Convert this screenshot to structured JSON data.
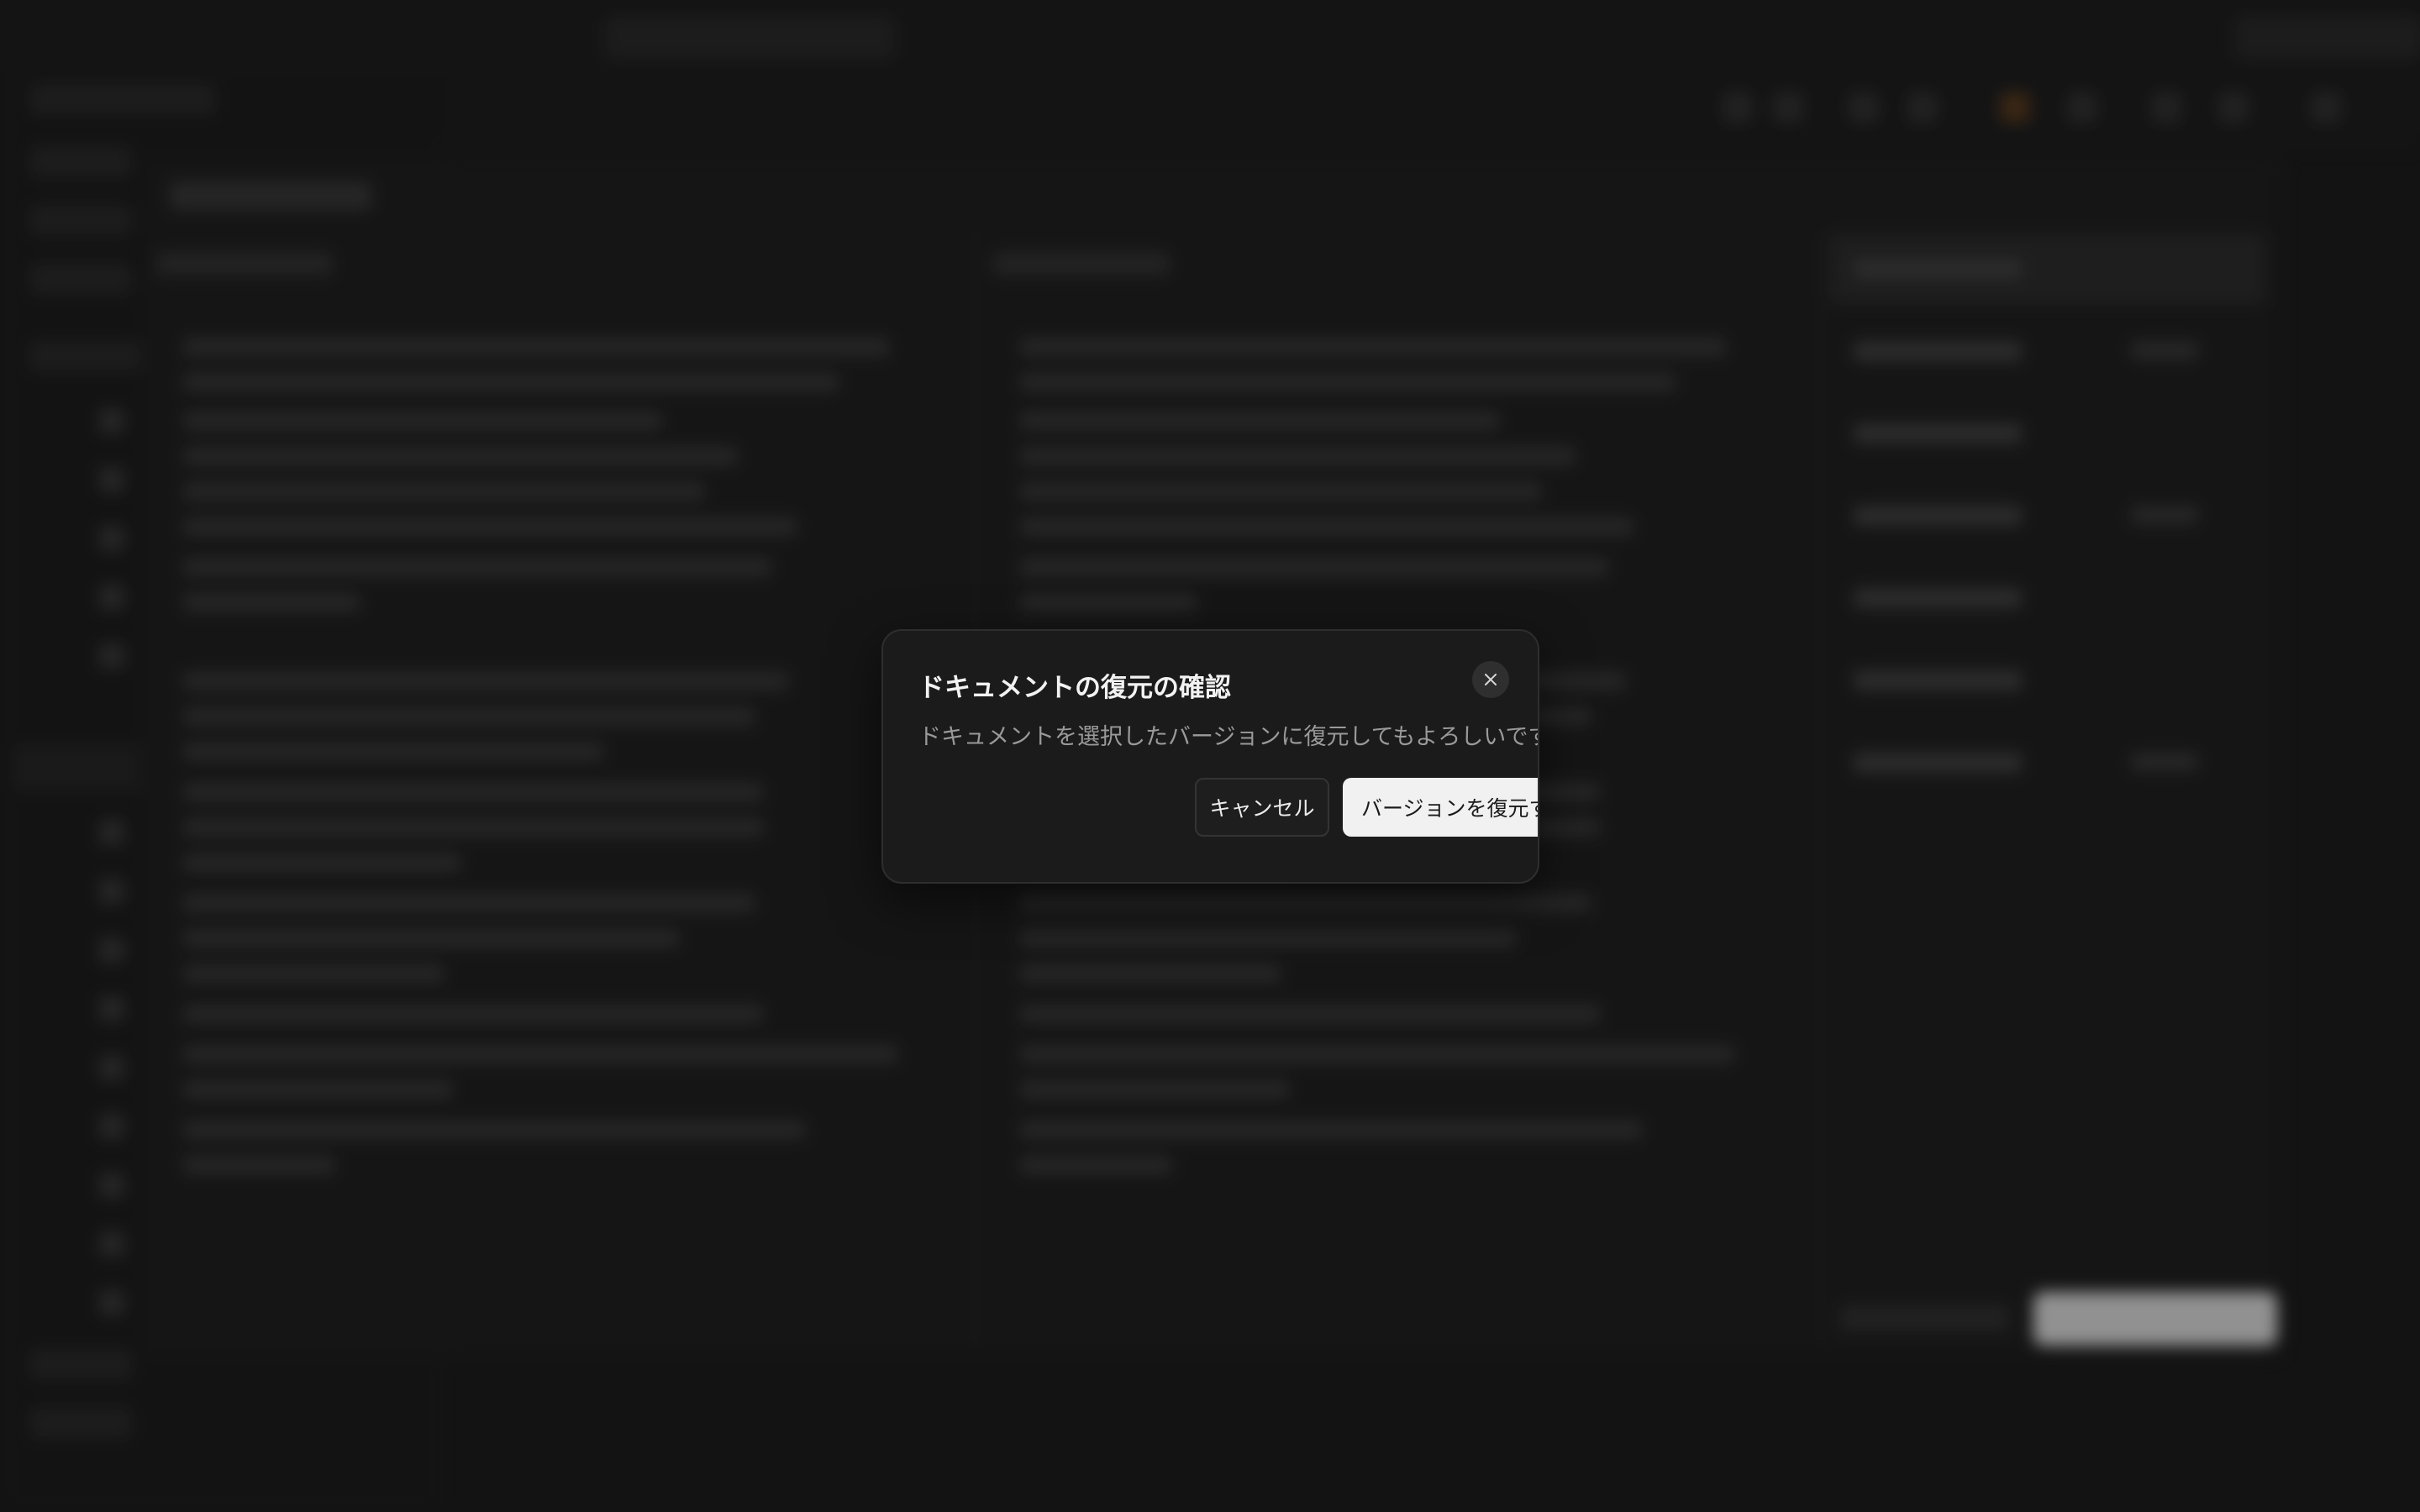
{
  "dialog": {
    "title": "ドキュメントの復元の確認",
    "description": "ドキュメントを選択したバージョンに復元してもよろしいですか？",
    "cancel_label": "キャンセル",
    "restore_label": "バージョンを復元する",
    "close_icon": "close-icon"
  },
  "colors": {
    "overlay": "#1b1b1b",
    "primary_button": "#f1f1f1",
    "secondary_button": "#1e1e1e"
  }
}
